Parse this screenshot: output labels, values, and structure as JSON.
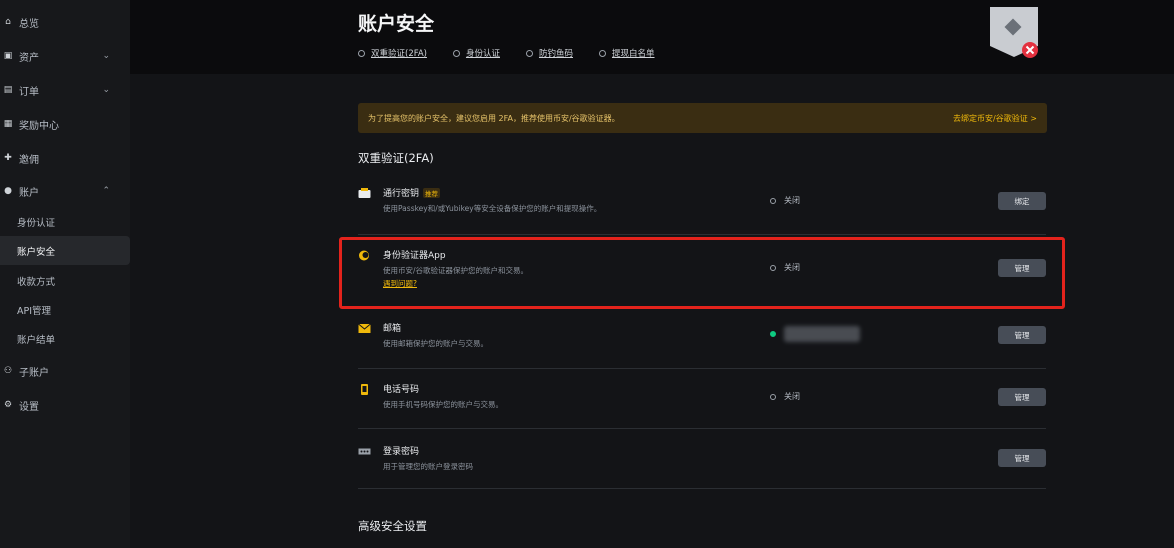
{
  "sidebar": {
    "items": [
      {
        "label": "总览",
        "icon": "home-icon"
      },
      {
        "label": "资产",
        "icon": "wallet-icon"
      },
      {
        "label": "订单",
        "icon": "orders-icon"
      },
      {
        "label": "奖励中心",
        "icon": "reward-icon"
      },
      {
        "label": "邀佣",
        "icon": "referral-icon"
      },
      {
        "label": "账户",
        "icon": "user-icon"
      },
      {
        "label": "子账户",
        "icon": "subaccount-icon"
      },
      {
        "label": "设置",
        "icon": "gear-icon"
      }
    ],
    "sub_items": [
      "身份认证",
      "账户安全",
      "收款方式",
      "API管理",
      "账户结单"
    ],
    "active": "账户安全"
  },
  "header": {
    "title": "账户安全",
    "tabs": [
      "双重验证(2FA)",
      "身份认证",
      "防钓鱼码",
      "提现白名单"
    ]
  },
  "banner": {
    "text": "为了提高您的账户安全，建议您启用 2FA，推荐使用币安/谷歌验证器。",
    "link": "去绑定币安/谷歌验证 >"
  },
  "section_2fa": {
    "title": "双重验证(2FA)",
    "rows": [
      {
        "name": "通行密钥",
        "tag": "推荐",
        "desc": "使用Passkey和/或Yubikey等安全设备保护您的账户和提现操作。",
        "status": "关闭",
        "button": "绑定",
        "icon": "passkey-icon"
      },
      {
        "name": "身份验证器App",
        "desc": "使用币安/谷歌验证器保护您的账户和交易。",
        "help": "遇到问题?",
        "status": "关闭",
        "button": "管理",
        "icon": "authenticator-icon"
      },
      {
        "name": "邮箱",
        "desc": "使用邮箱保护您的账户与交易。",
        "status": "",
        "button": "管理",
        "icon": "email-icon"
      },
      {
        "name": "电话号码",
        "desc": "使用手机号码保护您的账户与交易。",
        "status": "关闭",
        "button": "管理",
        "icon": "phone-icon"
      },
      {
        "name": "登录密码",
        "desc": "用于管理您的账户登录密码",
        "status": "",
        "button": "管理",
        "icon": "password-icon"
      }
    ]
  },
  "section_advanced": {
    "title": "高级安全设置"
  },
  "colors": {
    "accent": "#f0b90b",
    "highlight": "#e3231c",
    "success": "#0ecb81"
  }
}
